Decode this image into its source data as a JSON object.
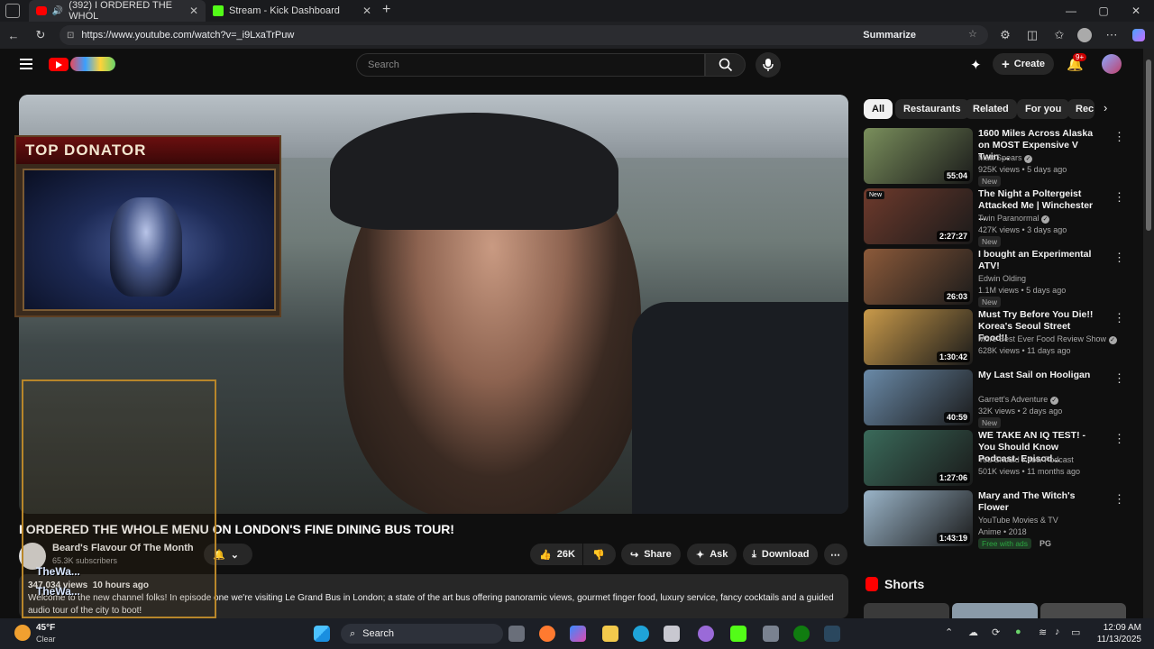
{
  "browser": {
    "tabs": [
      {
        "label": "(392) I ORDERED THE WHOL",
        "active": true
      },
      {
        "label": "Stream - Kick Dashboard",
        "active": false
      }
    ],
    "url": "https://www.youtube.com/watch?v=_i9LxaTrPuw",
    "summarize_label": "Summarize"
  },
  "masthead": {
    "search_placeholder": "Search",
    "create_label": "Create",
    "notifications_badge": "9+"
  },
  "video": {
    "title": "I ORDERED THE WHOLE MENU ON LONDON'S FINE DINING BUS TOUR!",
    "channel_name": "Beard's Flavour Of The Month",
    "subscribers": "65.3K subscribers",
    "likes": "26K",
    "share_label": "Share",
    "ask_label": "Ask",
    "download_label": "Download",
    "views": "347,034 views",
    "posted": "10 hours ago",
    "description_line1": "Welcome to the new channel folks! In episode one we're visiting Le Grand Bus in London; a state of the art bus offering panoramic views, gourmet finger food, luxury service, fancy cocktails and a guided",
    "description_line2": "audio tour of the city to boot!"
  },
  "overlay": {
    "top_donator_label": "TOP DONATOR",
    "name1": "TheWa...",
    "name2": "TheWa..."
  },
  "chips": [
    "All",
    "Restaurants",
    "Related",
    "For you",
    "Rec"
  ],
  "recommendations": [
    {
      "title": "1600 Miles Across Alaska on MOST Expensive V Twin ...",
      "channel": "Matt Spears",
      "verified": true,
      "meta": "925K views • 5 days ago",
      "badge": "New",
      "duration": "55:04",
      "thumb_color": "#7a8f5c"
    },
    {
      "title": "The Night a Poltergeist Attacked Me | Winchester ...",
      "channel": "Twin Paranormal",
      "verified": true,
      "meta": "427K views • 3 days ago",
      "badge": "New",
      "duration": "2:27:27",
      "thumb_color": "#6e3a2c",
      "thumb_badge": "New"
    },
    {
      "title": "I bought an Experimental ATV!",
      "channel": "Edwin Olding",
      "verified": false,
      "meta": "1.1M views • 5 days ago",
      "badge": "New",
      "duration": "26:03",
      "thumb_color": "#8c5a3a"
    },
    {
      "title": "Must Try Before You Die!! Korea's Seoul Street Food!!",
      "channel": "More Best Ever Food Review Show",
      "verified": true,
      "meta": "628K views • 11 days ago",
      "badge": "",
      "duration": "1:30:42",
      "thumb_color": "#c99a4a"
    },
    {
      "title": "My Last Sail on Hooligan",
      "channel": "Garrett's Adventure",
      "verified": true,
      "meta": "32K views • 2 days ago",
      "badge": "New",
      "duration": "40:59",
      "thumb_color": "#6a8aa8"
    },
    {
      "title": "WE TAKE AN IQ TEST! -You Should Know Podcast- Episod...",
      "channel": "You Should Know Podcast",
      "verified": false,
      "meta": "501K views • 11 months ago",
      "badge": "",
      "duration": "1:27:06",
      "thumb_color": "#3a6a5a"
    },
    {
      "title": "Mary and The Witch's Flower",
      "channel": "YouTube Movies & TV",
      "verified": false,
      "meta": "Anime • 2018",
      "badge": "Free with ads",
      "rating": "PG",
      "duration": "1:43:19",
      "thumb_color": "#9ab4c8"
    }
  ],
  "shorts_label": "Shorts",
  "taskbar": {
    "weather_temp": "45°F",
    "weather_desc": "Clear",
    "search_label": "Search",
    "time": "12:09 AM",
    "date": "11/13/2025"
  },
  "colors": {
    "accent": "#ff0000",
    "background": "#0f0f0f",
    "chip_active": "#f1f1f1",
    "free_with_ads": "#2ba640"
  }
}
